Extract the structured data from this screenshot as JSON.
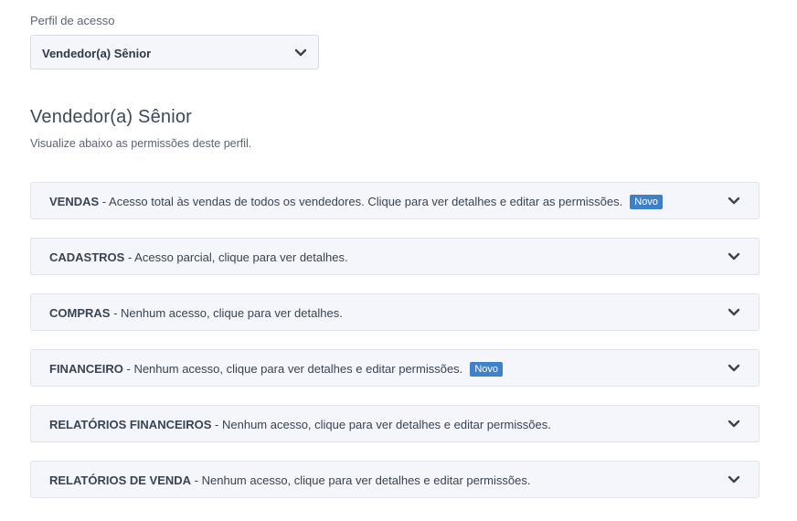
{
  "profile": {
    "label": "Perfil de acesso",
    "selected": "Vendedor(a) Sênior",
    "title": "Vendedor(a) Sênior",
    "description": "Visualize abaixo as permissões deste perfil."
  },
  "permissions": [
    {
      "module": "VENDAS",
      "detail": " - Acesso total às vendas de todos os vendedores. Clique para ver detalhes e editar as permissões.",
      "badge": "Novo"
    },
    {
      "module": "CADASTROS",
      "detail": " - Acesso parcial, clique para ver detalhes.",
      "badge": null
    },
    {
      "module": "COMPRAS",
      "detail": " - Nenhum acesso, clique para ver detalhes.",
      "badge": null
    },
    {
      "module": "FINANCEIRO",
      "detail": " - Nenhum acesso, clique para ver detalhes e editar permissões.",
      "badge": "Novo"
    },
    {
      "module": "RELATÓRIOS FINANCEIROS",
      "detail": " - Nenhum acesso, clique para ver detalhes e editar permissões.",
      "badge": null
    },
    {
      "module": "RELATÓRIOS DE VENDA",
      "detail": " - Nenhum acesso, clique para ver detalhes e editar permissões.",
      "badge": null
    }
  ],
  "icons": {
    "expand": "chevron-down-icon"
  },
  "colors": {
    "badge": "#3f80c8",
    "panel_bg": "#f4f6fb",
    "text": "#3a4350"
  }
}
